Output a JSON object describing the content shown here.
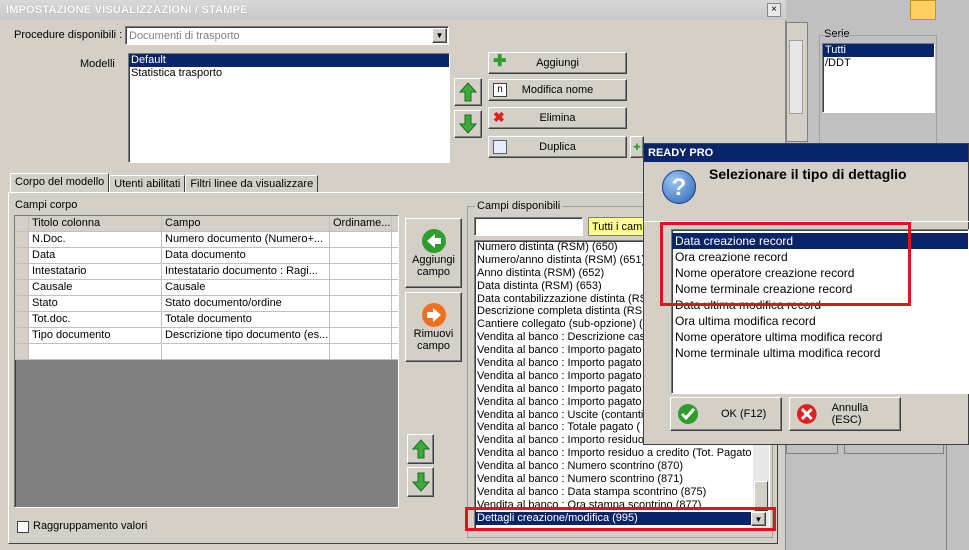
{
  "window": {
    "title": "IMPOSTAZIONE VISUALIZZAZIONI / STAMPE",
    "close_label": "×"
  },
  "procedure": {
    "label": "Procedure disponibili :",
    "value": "Documenti di trasporto"
  },
  "modelli": {
    "label": "Modelli",
    "items": [
      "Default",
      "Statistica trasporto"
    ],
    "selected": "Default"
  },
  "buttons": {
    "aggiungi": "Aggiungi",
    "modifica_nome": "Modifica nome",
    "elimina": "Elimina",
    "duplica": "Duplica"
  },
  "tabs": [
    "Corpo del modello",
    "Utenti abilitati",
    "Filtri linee da visualizzare"
  ],
  "campi_corpo": {
    "label": "Campi corpo",
    "columns": [
      "Titolo colonna",
      "Campo",
      "Ordiname..."
    ],
    "rows": [
      [
        "N.Doc.",
        "Numero documento (Numero+...",
        ""
      ],
      [
        "Data",
        "Data documento",
        ""
      ],
      [
        "Intestatario",
        "Intestatario documento : Ragi...",
        ""
      ],
      [
        "Causale",
        "Causale",
        ""
      ],
      [
        "Stato",
        "Stato documento/ordine",
        ""
      ],
      [
        "Tot.doc.",
        "Totale documento",
        ""
      ],
      [
        "Tipo documento",
        "Descrizione tipo documento (es...",
        ""
      ]
    ]
  },
  "mid_buttons": {
    "aggiungi_campo": "Aggiungi campo",
    "rimuovi_campo": "Rimuovi campo"
  },
  "raggruppamento": "Raggruppamento valori",
  "campi_disponibili": {
    "label": "Campi disponibili",
    "filter_value": "Tutti i camp",
    "items": [
      "Numero distinta (RSM) (650)",
      "Numero/anno distinta (RSM) (651)",
      "Anno distinta (RSM) (652)",
      "Data distinta (RSM) (653)",
      "Data contabilizzazione distinta (RSM",
      "Descrizione completa distinta (RSM",
      "Cantiere collegato (sub-opzione) (",
      "Vendita al banco : Descrizione cass",
      "Vendita al banco  : Importo pagato",
      "Vendita al banco : Importo pagato",
      "Vendita al banco : Importo pagato",
      "Vendita al banco : Importo pagato",
      "Vendita al banco : Importo pagato",
      "Vendita al banco : Uscite (contanti",
      "Vendita al banco : Totale pagato (",
      "Vendita al banco : Importo residuo",
      "Vendita al banco : Importo residuo a credito (Tot. Pagato",
      "Vendita al banco : Numero scontrino (870)",
      "Vendita al banco : Numero scontrino (871)",
      "Vendita al banco : Data stampa scontrino (875)",
      "Vendita al banco : Ora stampa scontrino (877)",
      "Dettagli creazione/modifica (995)"
    ],
    "selected": "Dettagli creazione/modifica (995)"
  },
  "serie": {
    "label": "Serie",
    "items": [
      "Tutti",
      "/DDT"
    ],
    "selected": "Tutti"
  },
  "dialog": {
    "title": "READY PRO",
    "question": "Selezionare il tipo di dettaglio",
    "items": [
      "Data creazione record",
      "Ora creazione record",
      "Nome operatore creazione record",
      "Nome terminale creazione record",
      "Data ultima modifica record",
      "Ora ultima modifica record",
      "Nome operatore ultima modifica record",
      "Nome terminale ultima modifica record"
    ],
    "selected": "Data creazione record",
    "ok": "OK (F12)",
    "annulla": "Annulla (ESC)"
  },
  "colors": {
    "selection": "#0a246a",
    "highlight_box": "#e0141e",
    "green": "#2e9d2e",
    "orange": "#f07020"
  }
}
